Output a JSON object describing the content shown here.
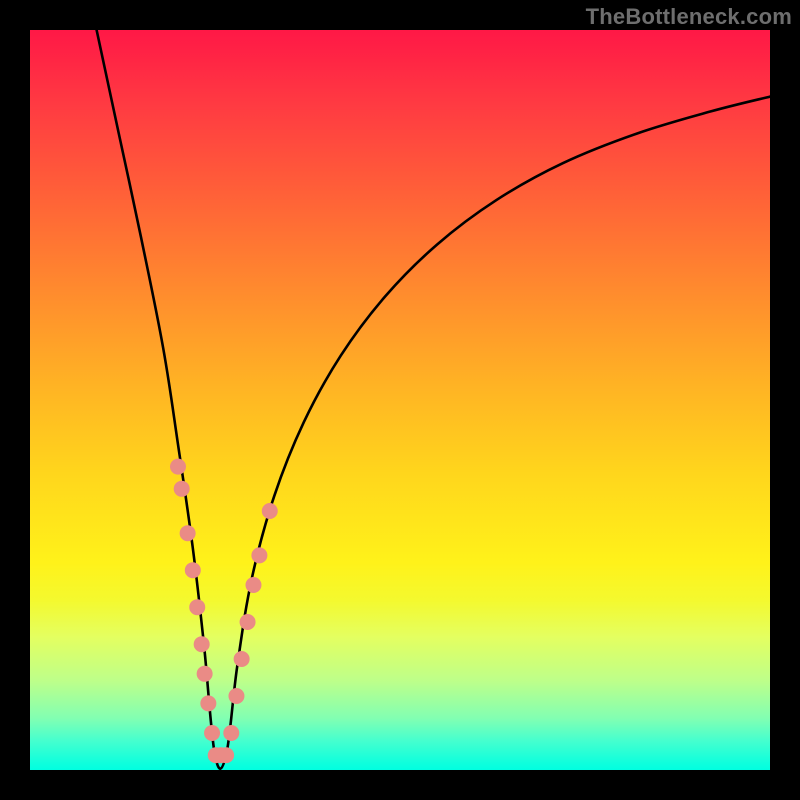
{
  "watermark": "TheBottleneck.com",
  "chart_data": {
    "type": "line",
    "title": "",
    "xlabel": "",
    "ylabel": "",
    "xlim": [
      0,
      100
    ],
    "ylim": [
      0,
      100
    ],
    "grid": false,
    "legend": false,
    "note": "Axes are unlabeled; values below are estimated in percent of the plot area (0,0 = bottom-left, 100,100 = top-right). The curve is a V-shaped bottleneck curve that rises steeply on both sides from a minimum near x≈25.",
    "series": [
      {
        "name": "bottleneck-curve",
        "x": [
          9,
          12,
          15,
          18,
          20,
          22,
          23.5,
          25,
          26.5,
          28,
          30,
          33,
          37,
          42,
          48,
          55,
          63,
          72,
          82,
          92,
          100
        ],
        "y": [
          100,
          86,
          72,
          57,
          44,
          30,
          17,
          2,
          2,
          14,
          26,
          37,
          47,
          56,
          64,
          71,
          77,
          82,
          86,
          89,
          91
        ]
      }
    ],
    "markers": {
      "name": "highlighted-range",
      "description": "Pink bead markers along the curve on both sides of the minimum, roughly between y≈2 and y≈32",
      "points": [
        {
          "x": 20.0,
          "y": 41
        },
        {
          "x": 20.5,
          "y": 38
        },
        {
          "x": 21.3,
          "y": 32
        },
        {
          "x": 22.0,
          "y": 27
        },
        {
          "x": 22.6,
          "y": 22
        },
        {
          "x": 23.2,
          "y": 17
        },
        {
          "x": 23.6,
          "y": 13
        },
        {
          "x": 24.1,
          "y": 9
        },
        {
          "x": 24.6,
          "y": 5
        },
        {
          "x": 25.1,
          "y": 2
        },
        {
          "x": 25.8,
          "y": 2
        },
        {
          "x": 26.5,
          "y": 2
        },
        {
          "x": 27.2,
          "y": 5
        },
        {
          "x": 27.9,
          "y": 10
        },
        {
          "x": 28.6,
          "y": 15
        },
        {
          "x": 29.4,
          "y": 20
        },
        {
          "x": 30.2,
          "y": 25
        },
        {
          "x": 31.0,
          "y": 29
        },
        {
          "x": 32.4,
          "y": 35
        }
      ],
      "color": "#ea8b86",
      "radius_px": 8
    },
    "gradient": {
      "top_color": "#ff1846",
      "bottom_color": "#00ffe0",
      "description": "Vertical red→orange→yellow→green gradient fill behind the curve"
    }
  }
}
